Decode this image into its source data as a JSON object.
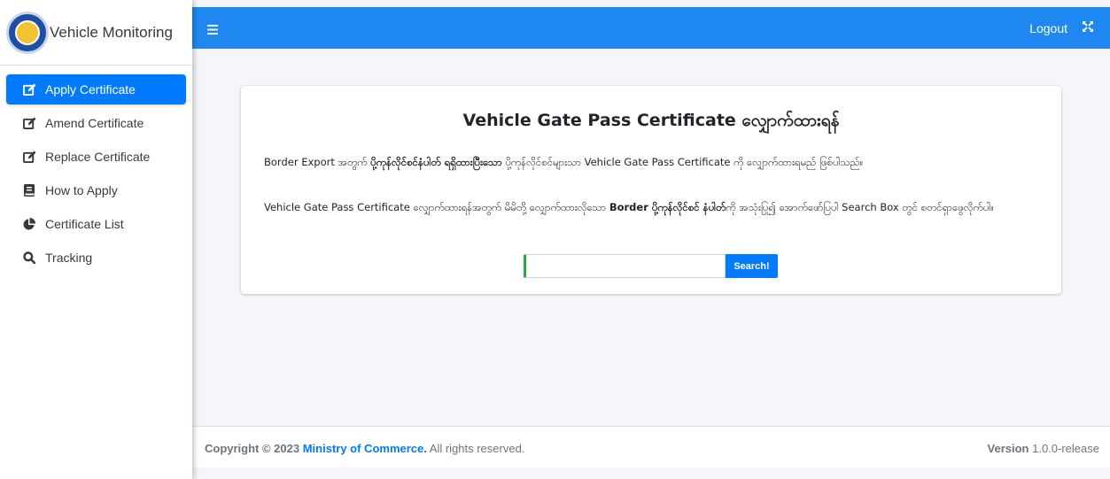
{
  "sidebar": {
    "brand": "Vehicle Monitoring",
    "items": [
      {
        "label": "Apply Certificate",
        "icon": "edit-icon"
      },
      {
        "label": "Amend Certificate",
        "icon": "edit-icon"
      },
      {
        "label": "Replace Certificate",
        "icon": "edit-icon"
      },
      {
        "label": "How to Apply",
        "icon": "book-icon"
      },
      {
        "label": "Certificate List",
        "icon": "pie-chart-icon"
      },
      {
        "label": "Tracking",
        "icon": "search-icon"
      }
    ],
    "active_index": 0
  },
  "header": {
    "logout": "Logout",
    "menu_icon": "hamburger-icon",
    "fullscreen_icon": "expand-icon"
  },
  "card": {
    "title": "Vehicle Gate Pass Certificate လျှောက်ထားရန်",
    "p1_a": "Border Export အတွက် ",
    "p1_b": "ပို့ကုန်လိုင်စင်နံပါတ် ရရှိထားပြီးသော",
    "p1_c": " ပို့ကုန်လိုင်စင်များသာ Vehicle Gate Pass Certificate ကို လျှောက်ထားရမည် ဖြစ်ပါသည်။",
    "p2_a": "Vehicle Gate Pass Certificate လျှောက်ထားရန်အတွက် မိမိတို့ လျှောက်ထားလိုသော ",
    "p2_b": "Border ပို့ကုန်လိုင်စင် နံပါတ်",
    "p2_c": "ကို အသုံးပြု၍ အောက်ဖော်ပြပါ Search Box တွင် စတင်ရှာဖွေလိုက်ပါ။",
    "search_value": "",
    "search_button": "Search!"
  },
  "footer": {
    "copyright_prefix": "Copyright © 2023 ",
    "ministry": "Ministry of Commerce.",
    "copyright_suffix": " All rights reserved.",
    "version_label": "Version",
    "version_value": " 1.0.0-release"
  },
  "colors": {
    "primary": "#007bff",
    "header": "#1e88f0",
    "accent_green": "#28a745"
  }
}
